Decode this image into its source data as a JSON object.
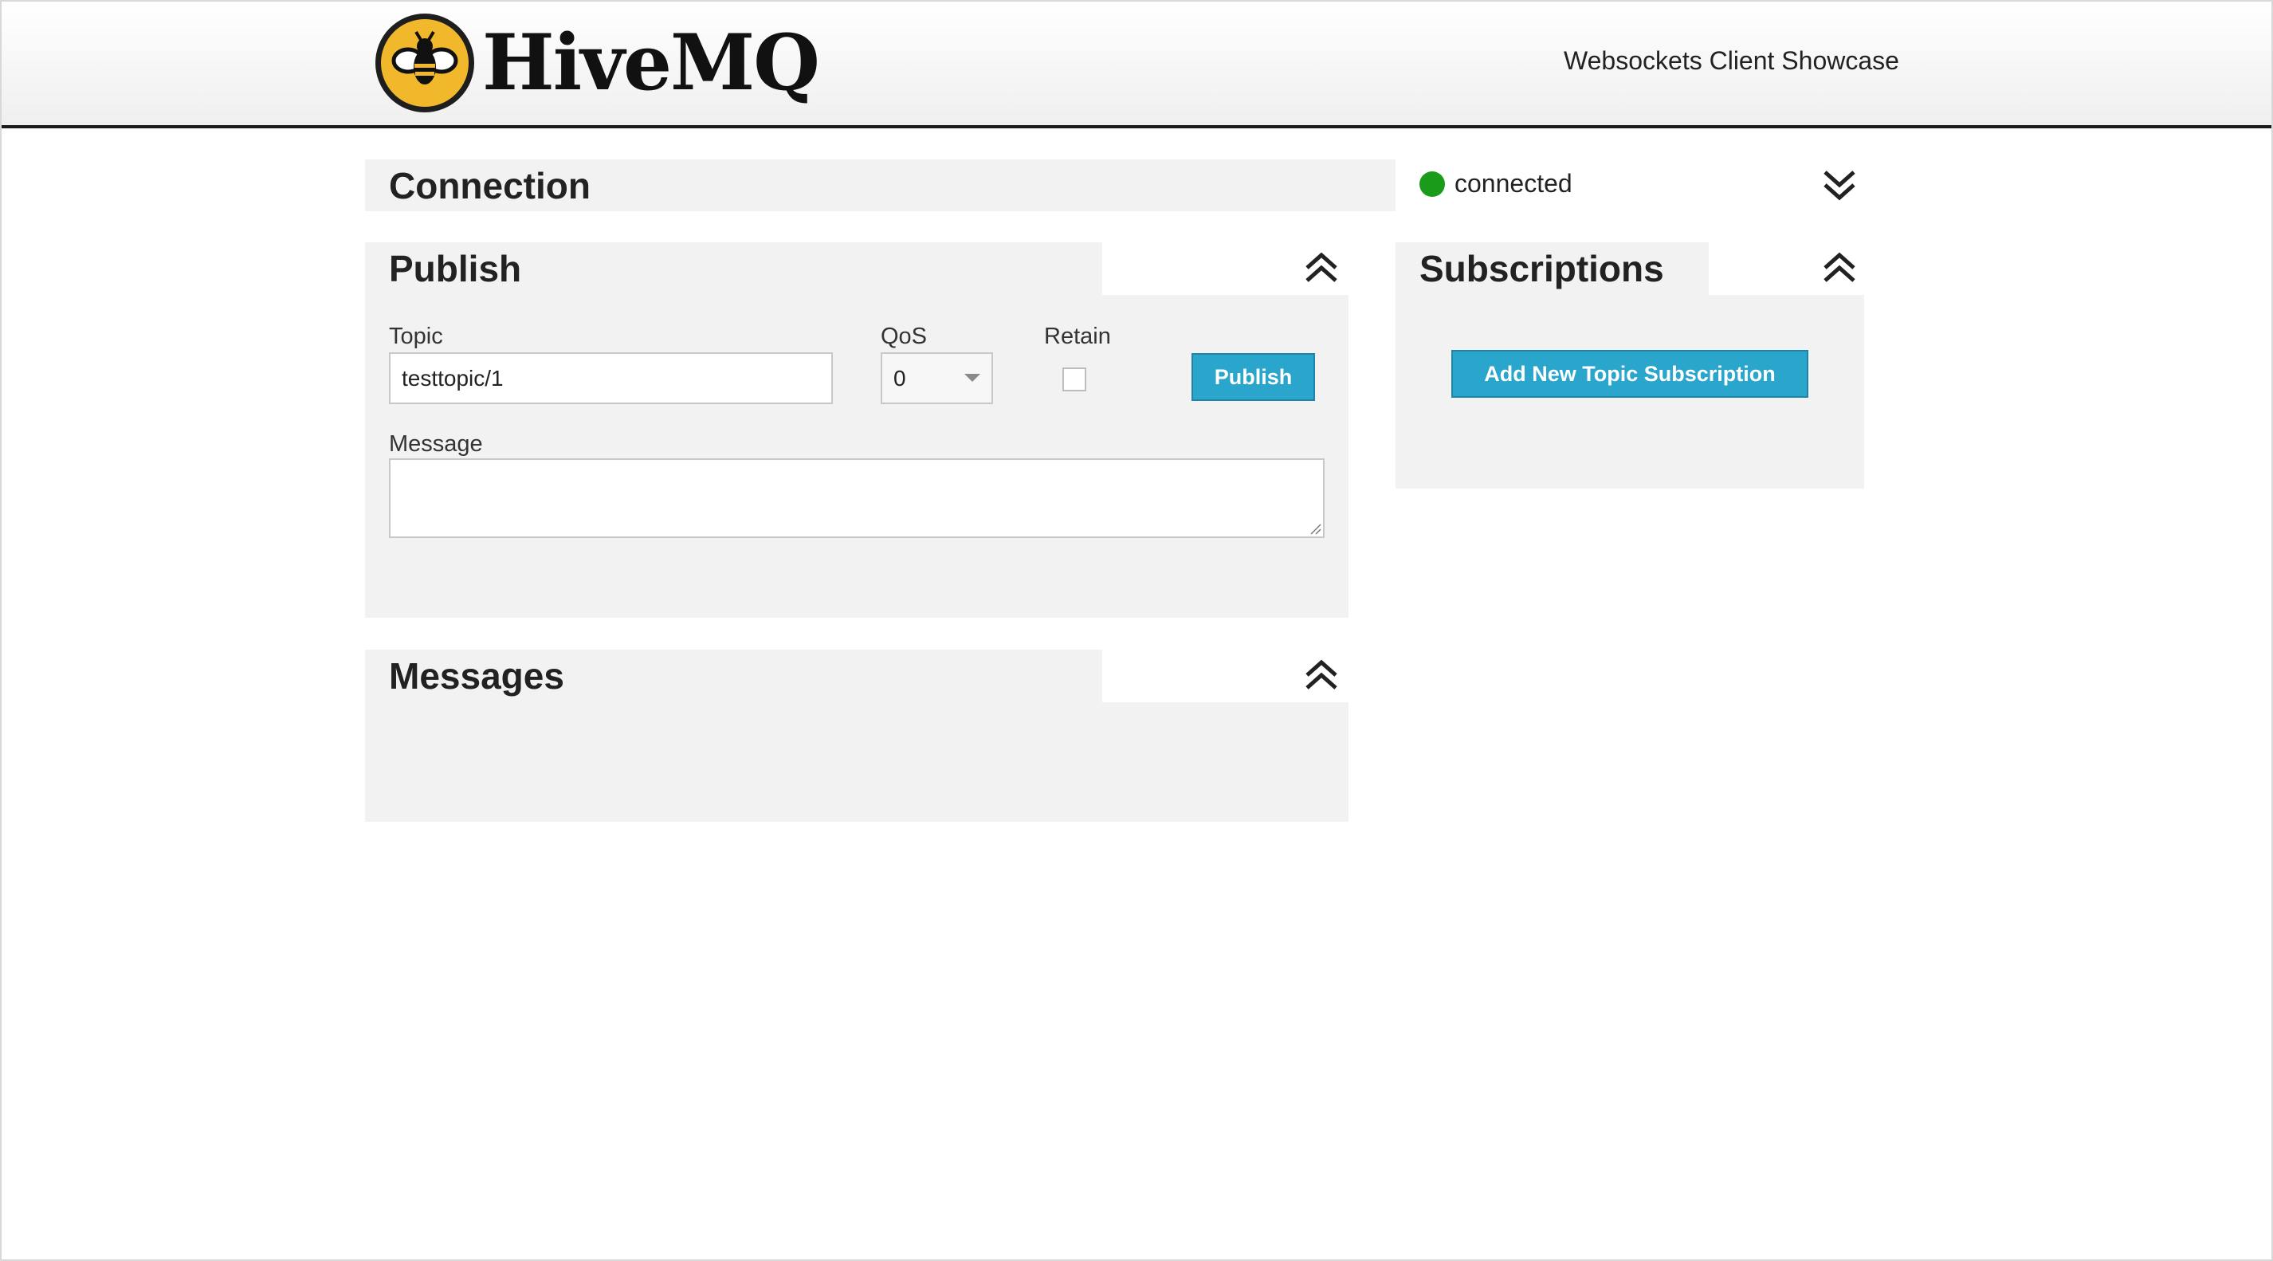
{
  "header": {
    "brand": "HiveMQ",
    "tagline": "Websockets Client Showcase"
  },
  "connection": {
    "title": "Connection",
    "status": "connected",
    "status_color": "#1a9c1a"
  },
  "publish": {
    "title": "Publish",
    "topic_label": "Topic",
    "topic_value": "testtopic/1",
    "qos_label": "QoS",
    "qos_value": "0",
    "retain_label": "Retain",
    "retain_checked": false,
    "button_label": "Publish",
    "message_label": "Message",
    "message_value": ""
  },
  "subscriptions": {
    "title": "Subscriptions",
    "add_button_label": "Add New Topic Subscription"
  },
  "messages": {
    "title": "Messages"
  },
  "colors": {
    "accent": "#2aa5cc",
    "panel_bg": "#f2f2f2",
    "logo_yellow": "#f2b82c"
  },
  "icons": [
    "bee-logo-icon",
    "chevron-double-up-icon",
    "chevron-double-down-icon",
    "dropdown-caret-icon",
    "resize-grip-icon"
  ]
}
